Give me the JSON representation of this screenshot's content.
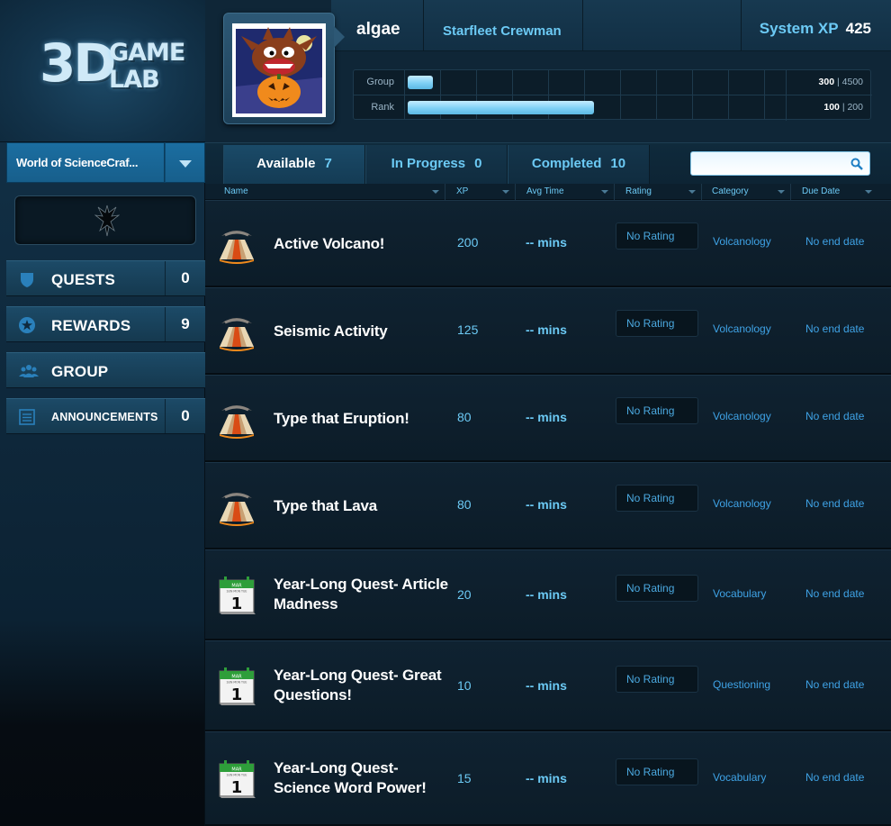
{
  "logo": {
    "big": "3D",
    "small_line1": "GAME",
    "small_line2": "LAB"
  },
  "sidebar": {
    "world_label": "World of ScienceCraf...",
    "nav": [
      {
        "label": "QUESTS",
        "count": "0",
        "icon": "shield-icon"
      },
      {
        "label": "REWARDS",
        "count": "9",
        "icon": "star-icon"
      },
      {
        "label": "GROUP",
        "count": "",
        "icon": "group-icon"
      },
      {
        "label": "ANNOUNCEMENTS",
        "count": "0",
        "icon": "list-icon"
      }
    ]
  },
  "header": {
    "username": "algae",
    "rank_title": "Starfleet Crewman",
    "system_xp_label": "System XP",
    "system_xp_value": "425",
    "group_label": "Group",
    "group_current": "300",
    "group_sep": "|",
    "group_total": "4500",
    "group_progress": 0.0667,
    "rank_label": "Rank",
    "rank_current": "100",
    "rank_sep": "|",
    "rank_total": "200",
    "rank_progress": 0.5
  },
  "tabs": [
    {
      "label": "Available",
      "count": "7"
    },
    {
      "label": "In Progress",
      "count": "0"
    },
    {
      "label": "Completed",
      "count": "10"
    }
  ],
  "search": {
    "value": "",
    "placeholder": ""
  },
  "columns": [
    "Name",
    "XP",
    "Avg Time",
    "Rating",
    "Category",
    "Due Date"
  ],
  "quests": [
    {
      "icon": "volcano-icon",
      "name": "Active Volcano!",
      "xp": "200",
      "time": "-- mins",
      "rating": "No Rating",
      "category": "Volcanology",
      "due": "No end date"
    },
    {
      "icon": "volcano-icon",
      "name": "Seismic Activity",
      "xp": "125",
      "time": "-- mins",
      "rating": "No Rating",
      "category": "Volcanology",
      "due": "No end date"
    },
    {
      "icon": "volcano-icon",
      "name": "Type that Eruption!",
      "xp": "80",
      "time": "-- mins",
      "rating": "No Rating",
      "category": "Volcanology",
      "due": "No end date"
    },
    {
      "icon": "volcano-icon",
      "name": "Type that Lava",
      "xp": "80",
      "time": "-- mins",
      "rating": "No Rating",
      "category": "Volcanology",
      "due": "No end date"
    },
    {
      "icon": "calendar-icon",
      "name": "Year-Long Quest- Article Madness",
      "xp": "20",
      "time": "-- mins",
      "rating": "No Rating",
      "category": "Vocabulary",
      "due": "No end date"
    },
    {
      "icon": "calendar-icon",
      "name": "Year-Long Quest- Great Questions!",
      "xp": "10",
      "time": "-- mins",
      "rating": "No Rating",
      "category": "Questioning",
      "due": "No end date"
    },
    {
      "icon": "calendar-icon",
      "name": "Year-Long Quest- Science Word Power!",
      "xp": "15",
      "time": "-- mins",
      "rating": "No Rating",
      "category": "Vocabulary",
      "due": "No end date"
    }
  ],
  "calendar_icon_text": {
    "day": "1",
    "month": "MAR",
    "days": "SUN MON TUE"
  }
}
